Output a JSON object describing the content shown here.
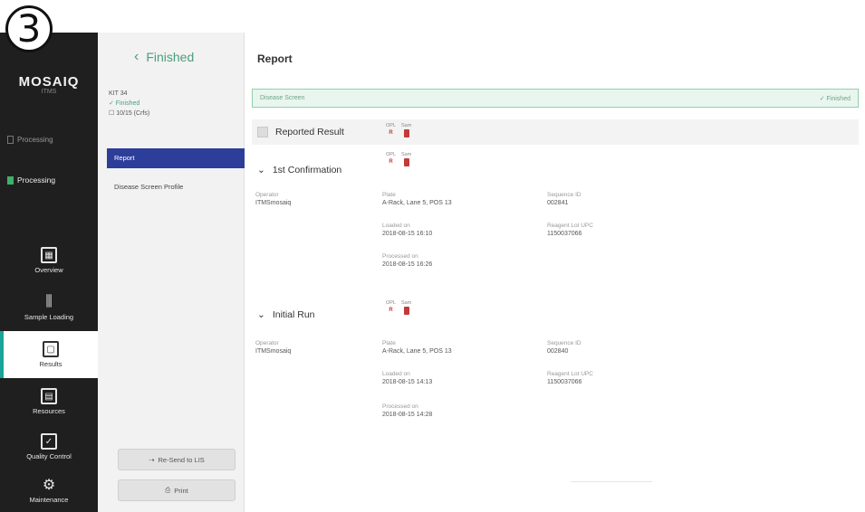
{
  "step_badge": "3",
  "brand": {
    "name": "MOSAIQ",
    "sub": "ITMS"
  },
  "nav_status": {
    "top_label": "Processing",
    "processing_label": "Processing"
  },
  "nav": [
    {
      "label": "Overview",
      "icon": "overview-icon",
      "glyph": "▦"
    },
    {
      "label": "Sample Loading",
      "icon": "sample-loading-icon",
      "glyph": "⫼"
    },
    {
      "label": "Results",
      "icon": "results-icon",
      "glyph": "▢"
    },
    {
      "label": "Resources",
      "icon": "resources-icon",
      "glyph": "▤"
    },
    {
      "label": "Quality Control",
      "icon": "quality-control-icon",
      "glyph": "✓"
    },
    {
      "label": "Maintenance",
      "icon": "maintenance-icon",
      "glyph": "⚙"
    }
  ],
  "side": {
    "back_label": "Finished",
    "kit_id": "KIT 34",
    "kit_status": "✓ Finished",
    "kit_sub": "☐ 10/15 (Crfs)",
    "menu_report": "Report",
    "menu_profile": "Disease Screen Profile",
    "resend_label": "Re-Send to LIS",
    "print_label": "Print"
  },
  "report": {
    "title": "Report",
    "disease_screen": "Disease Screen",
    "disease_status": "✓ Finished",
    "reported_result": "Reported Result",
    "first_conf": "1st Confirmation",
    "initial_run": "Initial Run",
    "count_labels": [
      "OPL",
      "Sam"
    ],
    "count_values": [
      "R",
      ""
    ],
    "first": {
      "operator_label": "Operator",
      "operator": "ITMSmosaiq",
      "plate_label": "Plate",
      "plate": "A-Rack, Lane 5, POS 13",
      "loaded_label": "Loaded on",
      "loaded": "2018-08-15 16:10",
      "processed_label": "Processed on",
      "processed": "2018-08-15 16:26",
      "sequence_label": "Sequence ID",
      "sequence": "002841",
      "reagent_label": "Reagent Lot UPC",
      "reagent": "1150037066"
    },
    "initial": {
      "operator_label": "Operator",
      "operator": "ITMSmosaiq",
      "plate_label": "Plate",
      "plate": "A-Rack, Lane 5, POS 13",
      "loaded_label": "Loaded on",
      "loaded": "2018-08-15 14:13",
      "processed_label": "Processed on",
      "processed": "2018-08-15 14:28",
      "sequence_label": "Sequence ID",
      "sequence": "002840",
      "reagent_label": "Reagent Lot UPC",
      "reagent": "1150037066"
    }
  }
}
